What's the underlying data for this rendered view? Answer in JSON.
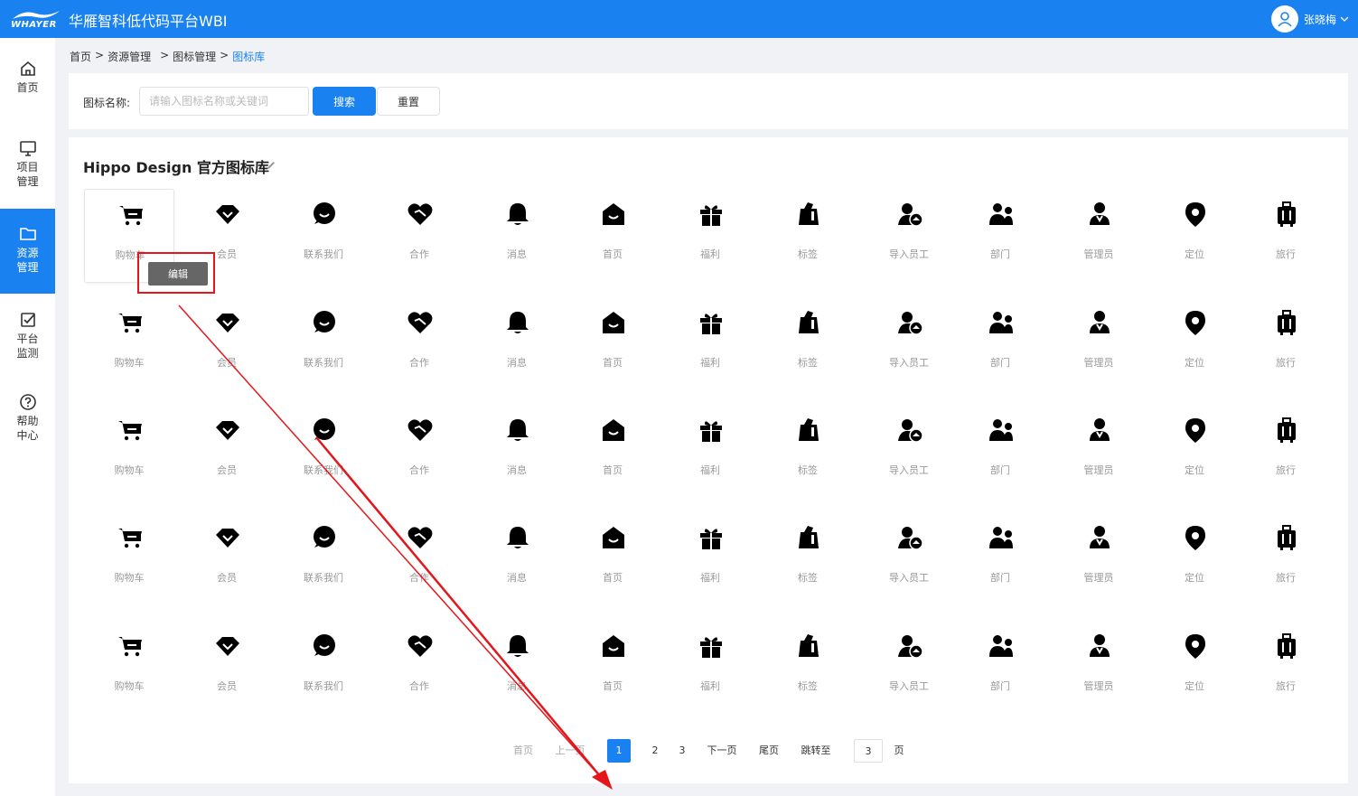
{
  "header": {
    "logo_text": "WHAYER",
    "title": "华雁智科低代码平台WBI",
    "user_name": "张晓梅",
    "brand_color": "#1a82f0"
  },
  "sidebar": {
    "items": [
      {
        "label": "首页",
        "icon": "home-icon"
      },
      {
        "label": "项目管理",
        "icon": "monitor-icon"
      },
      {
        "label": "资源管理",
        "icon": "folder-icon",
        "active": true
      },
      {
        "label": "平台监测",
        "icon": "checkbox-icon"
      },
      {
        "label": "帮助中心",
        "icon": "help-icon"
      }
    ]
  },
  "breadcrumb": [
    "首页",
    ">",
    "资源管理",
    ">",
    "图标管理",
    ">",
    "图标库"
  ],
  "search": {
    "label": "图标名称:",
    "placeholder": "请输入图标名称或关键词",
    "value": "",
    "search_label": "搜索",
    "reset_label": "重置"
  },
  "library": {
    "title": "Hippo Design 官方图标库",
    "icons": [
      {
        "label": "购物车",
        "icon": "cart-icon"
      },
      {
        "label": "会员",
        "icon": "member-icon"
      },
      {
        "label": "联系我们",
        "icon": "chat-icon"
      },
      {
        "label": "合作",
        "icon": "handshake-icon"
      },
      {
        "label": "消息",
        "icon": "bell-icon"
      },
      {
        "label": "首页",
        "icon": "home-filled-icon"
      },
      {
        "label": "福利",
        "icon": "gift-icon"
      },
      {
        "label": "标签",
        "icon": "tag-icon"
      },
      {
        "label": "导入员工",
        "icon": "user-import-icon"
      },
      {
        "label": "部门",
        "icon": "team-icon"
      },
      {
        "label": "管理员",
        "icon": "admin-icon"
      },
      {
        "label": "定位",
        "icon": "location-icon"
      },
      {
        "label": "旅行",
        "icon": "luggage-icon"
      }
    ],
    "rows": 5,
    "edit_popup": "编辑"
  },
  "pagination": {
    "first": "首页",
    "prev": "上一页",
    "pages": [
      "1",
      "2",
      "3"
    ],
    "current": "1",
    "next": "下一页",
    "last": "尾页",
    "jump_label": "跳转至",
    "jump_value": "3",
    "page_suffix": "页"
  },
  "annotation_color": "#e5161b"
}
